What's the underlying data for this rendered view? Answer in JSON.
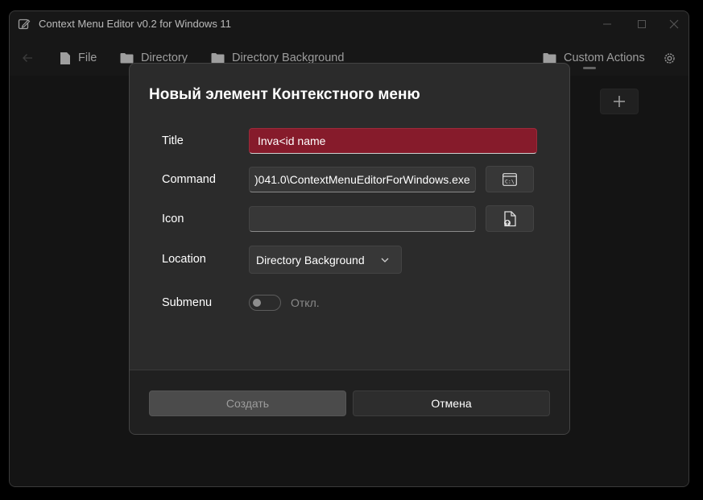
{
  "window": {
    "title": "Context Menu Editor v0.2 for Windows 11"
  },
  "nav": {
    "items": [
      {
        "label": "File"
      },
      {
        "label": "Directory"
      },
      {
        "label": "Directory Background"
      },
      {
        "label": "Custom Actions"
      }
    ]
  },
  "dialog": {
    "title": "Новый элемент Контекстного меню",
    "fields": {
      "title": {
        "label": "Title",
        "value": "Inva<id name"
      },
      "command": {
        "label": "Command",
        "value": ")041.0\\ContextMenuEditorForWindows.exe"
      },
      "icon": {
        "label": "Icon",
        "value": ""
      },
      "location": {
        "label": "Location",
        "value": "Directory Background"
      },
      "submenu": {
        "label": "Submenu",
        "state_text": "Откл."
      }
    },
    "buttons": {
      "create": "Создать",
      "cancel": "Отмена"
    }
  },
  "colors": {
    "error_field": "#861b2b",
    "window_bg": "#202020",
    "dialog_bg": "#2b2b2b"
  }
}
